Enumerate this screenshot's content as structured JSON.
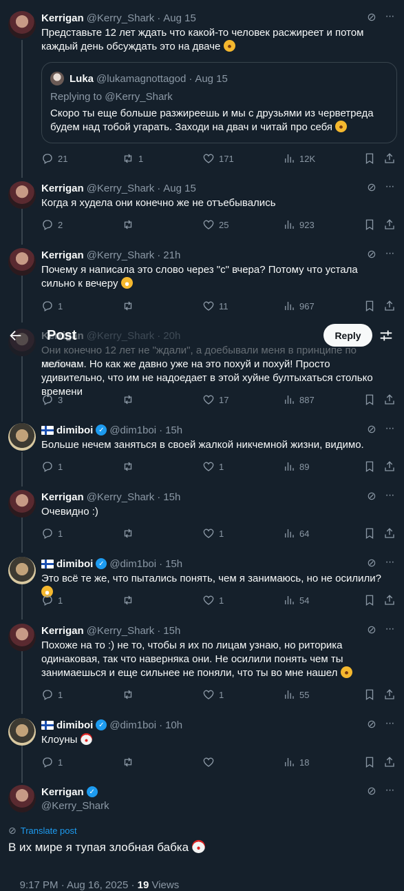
{
  "header": {
    "title": "Post",
    "reply_button": "Reply"
  },
  "tweets": [
    {
      "name": "Kerrigan",
      "handle": "@Kerry_Shark",
      "time": "Aug 15",
      "text": "Представьте 12 лет ждать что какой-то человек расжиреет и потом каждый день обсуждать это на дваче",
      "quote": {
        "name": "Luka",
        "handle": "@lukamagnottagod",
        "time": "Aug 15",
        "replying_to": "Replying to @Kerry_Shark",
        "text": "Скоро ты еще больше разжиреешь и мы с друзьями из черветреда будем над тобой угарать. Заходи на двач и читай про себя"
      },
      "stats": {
        "replies": "21",
        "reposts": "1",
        "likes": "171",
        "views": "12K"
      }
    },
    {
      "name": "Kerrigan",
      "handle": "@Kerry_Shark",
      "time": "Aug 15",
      "text": "Когда я худела они конечно же не отъебывались",
      "stats": {
        "replies": "2",
        "reposts": "",
        "likes": "25",
        "views": "923"
      }
    },
    {
      "name": "Kerrigan",
      "handle": "@Kerry_Shark",
      "time": "21h",
      "text": "Почему я написала это слово через \"с\" вчера? Потому что устала сильно к вечеру",
      "stats": {
        "replies": "1",
        "reposts": "",
        "likes": "11",
        "views": "967"
      }
    },
    {
      "name": "Kerrigan",
      "handle": "@Kerry_Shark",
      "time": "20h",
      "text_hidden": "Они конечно 12 лет не \"ждали\", а доебывали меня в принципе по любым",
      "text": "мелочам. Но как же давно уже на это похуй и похуй! Просто удивительно, что им не надоедает в этой хуйне бултыхаться столько времени",
      "stats": {
        "replies": "3",
        "reposts": "",
        "likes": "17",
        "views": "887"
      }
    },
    {
      "name": "dimiboi",
      "handle": "@dim1boi",
      "time": "15h",
      "text": "Больше нечем заняться в своей жалкой никчемной жизни, видимо.",
      "stats": {
        "replies": "1",
        "reposts": "",
        "likes": "1",
        "views": "89"
      }
    },
    {
      "name": "Kerrigan",
      "handle": "@Kerry_Shark",
      "time": "15h",
      "text": "Очевидно :)",
      "stats": {
        "replies": "1",
        "reposts": "",
        "likes": "1",
        "views": "64"
      }
    },
    {
      "name": "dimiboi",
      "handle": "@dim1boi",
      "time": "15h",
      "text": "Это всё те же, что пытались понять, чем я занимаюсь, но не осилили?",
      "stats": {
        "replies": "1",
        "reposts": "",
        "likes": "1",
        "views": "54"
      }
    },
    {
      "name": "Kerrigan",
      "handle": "@Kerry_Shark",
      "time": "15h",
      "text": "Похоже на то :) не то, чтобы я их по лицам узнаю, но риторика одинаковая, так что наверняка они. Не осилили понять чем ты занимаешься и еще сильнее не поняли, что ты во мне нашел",
      "stats": {
        "replies": "1",
        "reposts": "",
        "likes": "1",
        "views": "55"
      }
    },
    {
      "name": "dimiboi",
      "handle": "@dim1boi",
      "time": "10h",
      "text": "Клоуны",
      "stats": {
        "replies": "1",
        "reposts": "",
        "likes": "",
        "views": "18"
      }
    }
  ],
  "main_tweet": {
    "name": "Kerrigan",
    "handle": "@Kerry_Shark",
    "translate": "Translate post",
    "text": "В их мире я тупая злобная бабка",
    "timestamp": "9:17 PM · Aug 16, 2025 · ",
    "views_count": "19",
    "views_label": " Views"
  },
  "colors": {
    "background": "#15202b",
    "text": "#f7f9f9",
    "muted": "#8b98a5",
    "border": "#38444d",
    "accent": "#1d9bf0"
  }
}
